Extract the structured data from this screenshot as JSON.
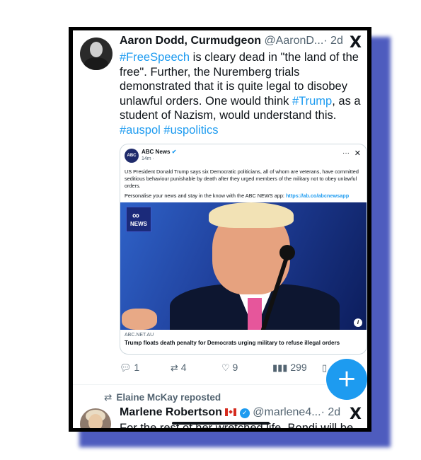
{
  "post": {
    "display_name": "Aaron Dodd, Curmudgeon",
    "handle": "@AaronD...",
    "time": "· 2d",
    "x_logo": "X",
    "text": {
      "tag1": "#FreeSpeech",
      "p1": " is cleary dead in \"the land of the free\". Further, the Nuremberg trials demonstrated that it is quite legal to disobey unlawful orders. One would think ",
      "tag2": "#Trump",
      "p2": ", as a student of Nazism, would understand this.",
      "tag3": "#auspol",
      "tag4": "#uspolitics"
    },
    "card": {
      "account_logo": "ABC NEWS",
      "account_name": "ABC News",
      "verified_mark": "✔",
      "time": "14m · ",
      "menu": "···",
      "close": "✕",
      "body": "US President Donald Trump says six Democratic politicians, all of whom are veterans, have committed seditious behaviour punishable by death after they urged members of the military not to obey unlawful orders.",
      "promo": "Personalise your news and stay in the know with the ABC NEWS app: ",
      "promo_link": "https://ab.co/abcnewsapp",
      "image_logo": "NEWS",
      "info": "i",
      "domain": "ABC.NET.AU",
      "title": "Trump floats death penalty for Democrats urging military to refuse illegal orders"
    },
    "actions": {
      "replies": "1",
      "reposts": "4",
      "likes": "9",
      "views": "299"
    }
  },
  "fab": {
    "label": "+"
  },
  "repost_line": {
    "text": "Elaine McKay reposted"
  },
  "next_post": {
    "display_name": "Marlene Robertson",
    "handle": "@marlene4...",
    "time": "· 2d",
    "x_logo": "X",
    "text_cut": "For the rest of her wretched life, Bondi will be"
  }
}
